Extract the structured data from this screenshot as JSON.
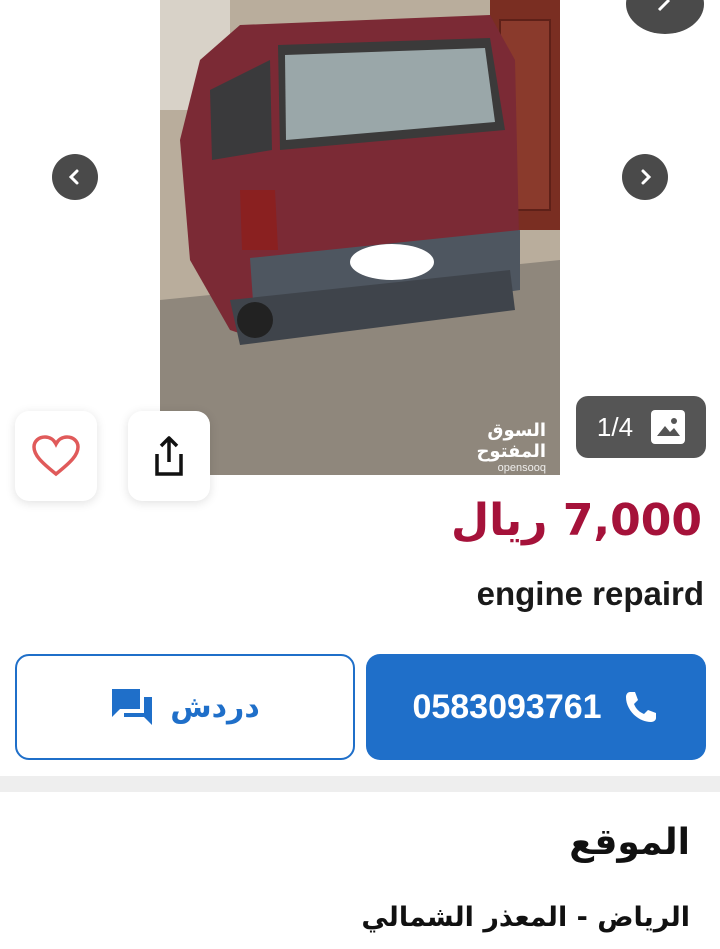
{
  "listing": {
    "image_counter": "1/4",
    "watermark_ar": "السوق المفتوح",
    "watermark_en": "opensooq",
    "price": "7,000 ريال",
    "title": "engine repaird"
  },
  "actions": {
    "phone_number": "0583093761",
    "chat_label": "دردش"
  },
  "location": {
    "heading": "الموقع",
    "value": "الرياض - المعذر الشمالي"
  },
  "colors": {
    "price": "#a5123a",
    "primary": "#1f6fc9",
    "favorite": "#e05a5a"
  },
  "icons": [
    "chevron-left-icon",
    "chevron-right-icon",
    "image-icon",
    "heart-icon",
    "share-icon",
    "phone-icon",
    "chat-icon"
  ]
}
